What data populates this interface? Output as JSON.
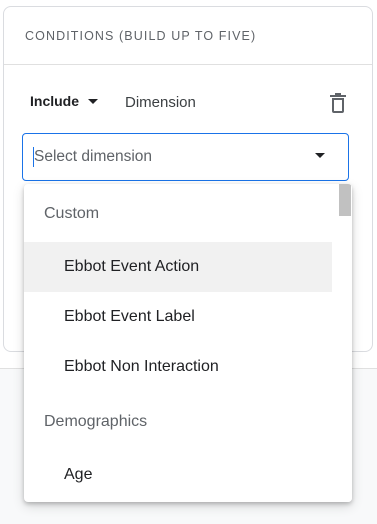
{
  "card": {
    "title": "CONDITIONS (BUILD UP TO FIVE)"
  },
  "condition": {
    "mode_label": "Include",
    "field_label": "Dimension",
    "delete_icon": "trash-icon"
  },
  "select": {
    "placeholder": "Select dimension",
    "value": ""
  },
  "menu": {
    "groups": [
      {
        "label": "Custom",
        "items": [
          "Ebbot Event Action",
          "Ebbot Event Label",
          "Ebbot Non Interaction"
        ]
      },
      {
        "label": "Demographics",
        "items": [
          "Age"
        ]
      }
    ],
    "hovered_item": "Ebbot Event Action"
  },
  "colors": {
    "accent": "#1a73e8",
    "hover": "#f1f1f1",
    "muted_text": "#5f6368"
  }
}
